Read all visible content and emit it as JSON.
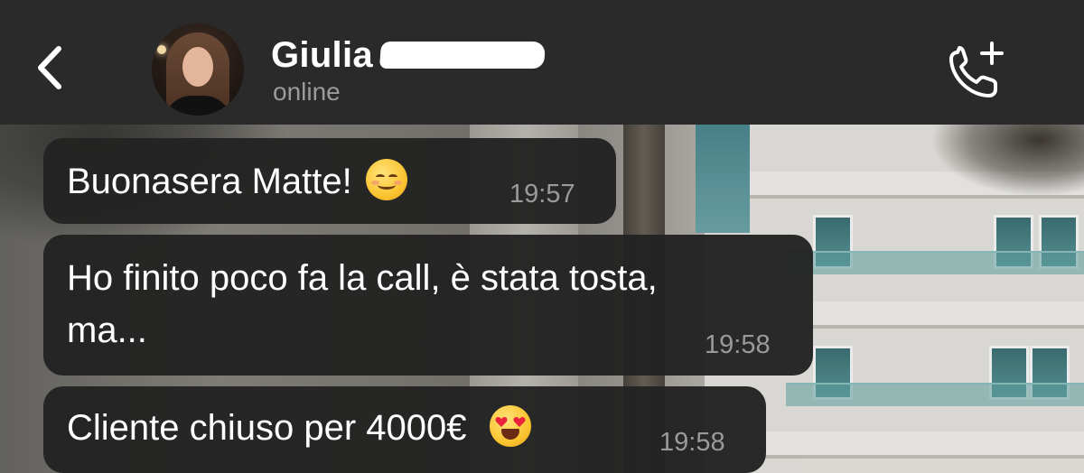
{
  "header": {
    "contact_name": "Giulia",
    "status": "online",
    "back_label": "Back",
    "call_label": "Add call"
  },
  "messages": [
    {
      "text": "Buonasera Matte!",
      "emoji": "smiling-face-icon",
      "time": "19:57"
    },
    {
      "text_line1": "Ho finito poco fa la call, è stata tosta,",
      "text_line2": "ma...",
      "time": "19:58"
    },
    {
      "text": "Cliente chiuso per 4000€",
      "emoji": "heart-eyes-icon",
      "time": "19:58"
    }
  ],
  "colors": {
    "header_bg": "#2a2a2a",
    "bubble_bg": "#232323",
    "text": "#ffffff",
    "muted": "#9a9a9a"
  }
}
